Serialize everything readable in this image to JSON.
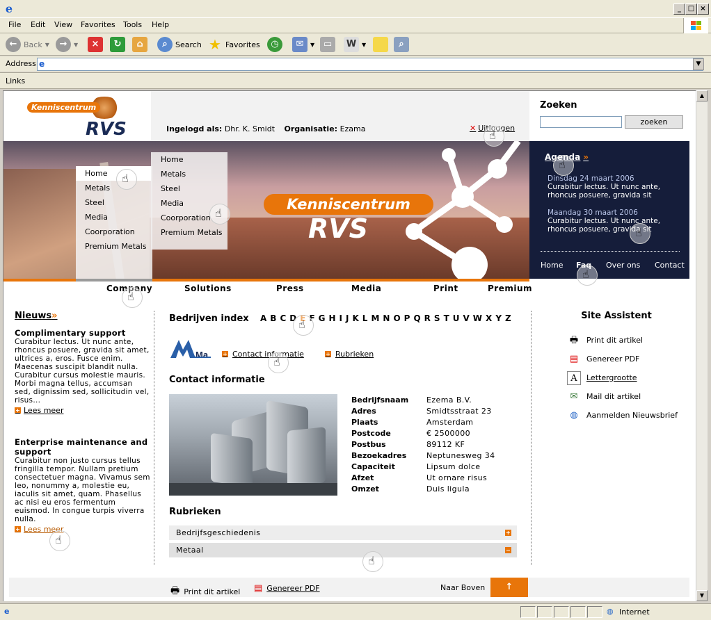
{
  "browser": {
    "menu": [
      "File",
      "Edit",
      "View",
      "Favorites",
      "Tools",
      "Help"
    ],
    "toolbar": {
      "back": "Back",
      "search": "Search",
      "favorites": "Favorites"
    },
    "address_label": "Address",
    "links_label": "Links",
    "status": "Internet"
  },
  "header": {
    "logo_top": "Kenniscentrum",
    "logo_main": "RVS",
    "logged_in_label": "Ingelogd als:",
    "logged_in_user": "Dhr. K. Smidt",
    "org_label": "Organisatie:",
    "org_value": "Ezama",
    "logout": "Uitloggen"
  },
  "search": {
    "title": "Zoeken",
    "button": "zoeken"
  },
  "hero": {
    "logo_top": "Kenniscentrum",
    "logo_main": "RVS"
  },
  "menu1": [
    "Home",
    "Metals",
    "Steel",
    "Media",
    "Coorporation",
    "Premium Metals"
  ],
  "menu2": [
    "Home",
    "Metals",
    "Steel",
    "Media",
    "Coorporation",
    "Premium Metals"
  ],
  "agenda": {
    "title": "Agenda",
    "arrow": "»",
    "items": [
      {
        "date": "Dinsdag 24 maart 2006",
        "text": "Curabitur lectus. Ut nunc ante, rhoncus posuere, gravida sit"
      },
      {
        "date": "Maandag 30 maart 2006",
        "text": "Curabitur lectus. Ut nunc ante, rhoncus posuere, gravida sit"
      }
    ],
    "links": [
      "Home",
      "Faq",
      "Over ons",
      "Contact"
    ]
  },
  "nav": [
    "Company",
    "Solutions",
    "Press",
    "Media",
    "Print",
    "Premium"
  ],
  "news": {
    "title": "Nieuws",
    "arrow": "»",
    "items": [
      {
        "heading": "Complimentary support",
        "body": "Curabitur lectus. Ut nunc ante, rhoncus posuere, gravida sit amet, ultrices a, eros. Fusce enim. Maecenas suscipit blandit nulla. Curabitur cursus molestie mauris. Morbi magna tellus, accumsan sed, dignissim sed, sollicitudin vel, risus...",
        "more": "Lees meer"
      },
      {
        "heading": "Enterprise maintenance and support",
        "body": "Curabitur non justo cursus tellus fringilla tempor. Nullam pretium consectetuer magna. Vivamus sem leo, nonummy a, molestie eu, iaculis sit amet, quam. Phasellus ac nisi eu eros fermentum euismod. In congue turpis viverra nulla.",
        "more": "Lees meer"
      }
    ]
  },
  "index": {
    "title": "Bedrijven index",
    "letters": [
      "A",
      "B",
      "C",
      "D",
      "E",
      "F",
      "G",
      "H",
      "I",
      "J",
      "K",
      "L",
      "M",
      "N",
      "O",
      "P",
      "Q",
      "R",
      "S",
      "T",
      "U",
      "V",
      "W",
      "X",
      "Y",
      "Z"
    ],
    "active_letter": "E",
    "tab_contact": "Contact informatie",
    "tab_rubrieken": "Rubrieken",
    "company_logo_text": "Ma"
  },
  "contact": {
    "title": "Contact informatie",
    "rows": [
      {
        "label": "Bedrijfsnaam",
        "value": "Ezema B.V."
      },
      {
        "label": "Adres",
        "value": "Smidtsstraat 23"
      },
      {
        "label": "Plaats",
        "value": "Amsterdam"
      },
      {
        "label": "Postcode",
        "value": "€ 2500000"
      },
      {
        "label": "Postbus",
        "value": "89112 KF"
      },
      {
        "label": "Bezoekadres",
        "value": "Neptunesweg 34"
      },
      {
        "label": "Capaciteit",
        "value": "Lipsum dolce"
      },
      {
        "label": "Afzet",
        "value": "Ut ornare risus"
      },
      {
        "label": "Omzet",
        "value": "Duis ligula"
      }
    ]
  },
  "rubrieken": {
    "title": "Rubrieken",
    "items": [
      {
        "label": "Bedrijfsgeschiedenis",
        "toggle": "+"
      },
      {
        "label": "Metaal",
        "toggle": "−"
      }
    ]
  },
  "assistant": {
    "title": "Site Assistent",
    "items": [
      {
        "label": "Print dit artikel",
        "icon": "🖶"
      },
      {
        "label": "Genereer PDF",
        "icon": "▤"
      },
      {
        "label": "Lettergrootte",
        "icon": "A"
      },
      {
        "label": "Mail dit artikel",
        "icon": "✉"
      },
      {
        "label": "Aanmelden Nieuwsbrief",
        "icon": "◍"
      }
    ]
  },
  "footer": {
    "print": "Print dit artikel",
    "pdf": "Genereer PDF",
    "top": "Naar Boven",
    "top_arrow": "↑"
  },
  "colors": {
    "accent": "#e8750a",
    "navy": "#151d3a"
  }
}
